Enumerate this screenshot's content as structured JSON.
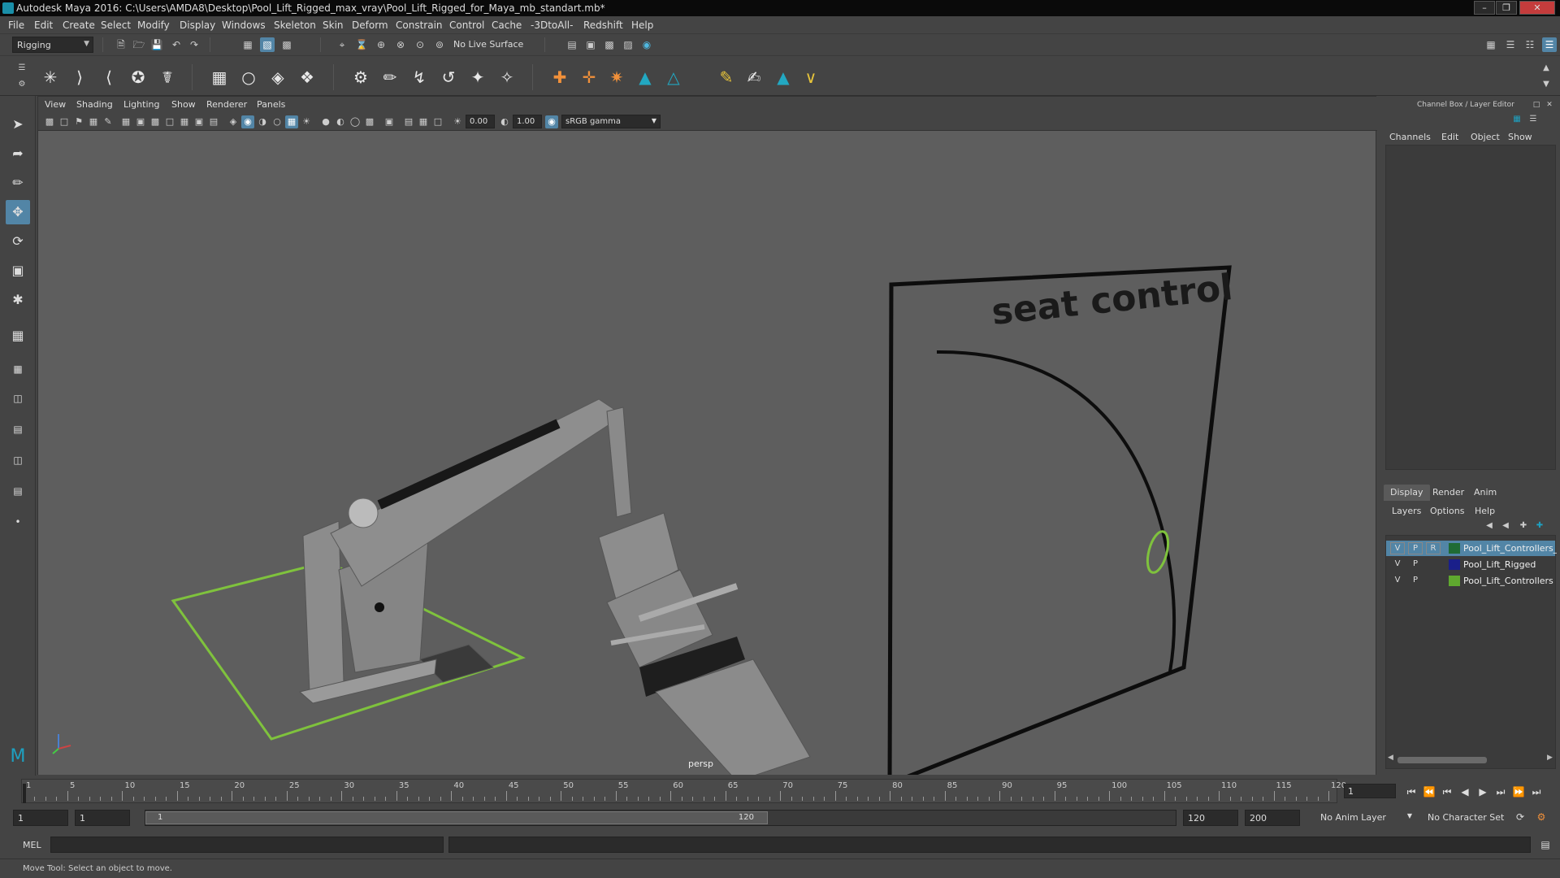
{
  "window": {
    "title": "Autodesk Maya 2016: C:\\Users\\AMDA8\\Desktop\\Pool_Lift_Rigged_max_vray\\Pool_Lift_Rigged_for_Maya_mb_standart.mb*",
    "min_icon": "minimize-icon",
    "max_icon": "maximize-icon",
    "close_icon": "close-icon"
  },
  "menubar": [
    "File",
    "Edit",
    "Create",
    "Select",
    "Modify",
    "Display",
    "Windows",
    "Skeleton",
    "Skin",
    "Deform",
    "Constrain",
    "Control",
    "Cache",
    "-3DtoAll-",
    "Redshift",
    "Help"
  ],
  "statusline": {
    "menuset": "Rigging",
    "live_surface": "No Live Surface"
  },
  "viewport": {
    "menus": [
      "View",
      "Shading",
      "Lighting",
      "Show",
      "Renderer",
      "Panels"
    ],
    "exposure": "0.00",
    "gamma": "1.00",
    "color_space": "sRGB gamma",
    "camera": "persp",
    "scene_text": "seat control"
  },
  "rightpanel": {
    "header": "Channel Box / Layer Editor",
    "channel_menus": [
      "Channels",
      "Edit",
      "Object",
      "Show"
    ],
    "tabs": [
      "Display",
      "Render",
      "Anim"
    ],
    "active_tab": "Display",
    "layer_menus": [
      "Layers",
      "Options",
      "Help"
    ],
    "layers": [
      {
        "v": "V",
        "p": "P",
        "r": "R",
        "color": "#1f6b34",
        "name": "Pool_Lift_Controllers_F",
        "selected": true
      },
      {
        "v": "V",
        "p": "P",
        "r": "",
        "color": "#1a1f8a",
        "name": "Pool_Lift_Rigged",
        "selected": false
      },
      {
        "v": "V",
        "p": "P",
        "r": "",
        "color": "#5fa82f",
        "name": "Pool_Lift_Controllers",
        "selected": false
      }
    ]
  },
  "timeline": {
    "ticks": [
      "1",
      "5",
      "10",
      "15",
      "20",
      "25",
      "30",
      "35",
      "40",
      "45",
      "50",
      "55",
      "60",
      "65",
      "70",
      "75",
      "80",
      "85",
      "90",
      "95",
      "100",
      "105",
      "110",
      "115",
      "120"
    ],
    "current_frame": "1"
  },
  "range": {
    "start": "1",
    "playback_start": "1",
    "slider_start": "1",
    "slider_end": "120",
    "playback_end": "120",
    "end": "200",
    "anim_layer": "No Anim Layer",
    "character_set": "No Character Set"
  },
  "cmdline": {
    "label": "MEL"
  },
  "helpline": {
    "text": "Move Tool: Select an object to move."
  }
}
